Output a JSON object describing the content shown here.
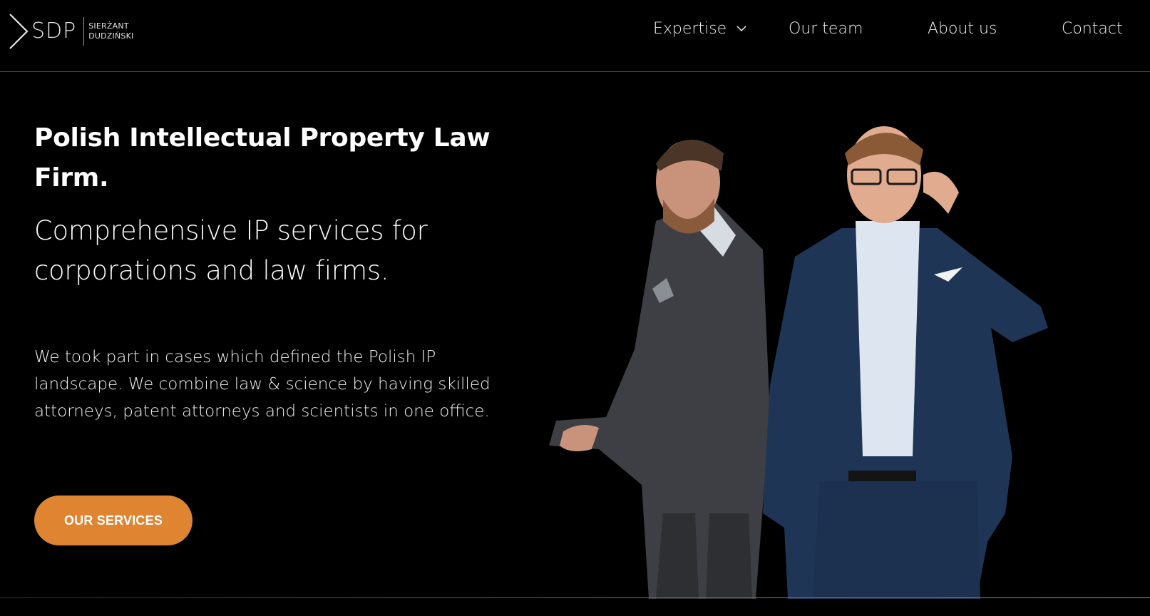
{
  "header": {
    "logo": {
      "abbr": "SDP",
      "name_line1": "SIERŻANT",
      "name_line2": "DUDZIŃSKI",
      "accent": "#d9873a"
    },
    "nav": {
      "expertise": "Expertise",
      "team": "Our team",
      "about": "About us",
      "contact": "Contact"
    }
  },
  "hero": {
    "title": "Polish Intellectual Property Law Firm.",
    "subtitle": "Comprehensive IP services for corporations and law firms.",
    "body": "We took part in cases which defined the Polish IP landscape. We combine law & science by having skilled attorneys, patent attorneys and scientists in one office.",
    "cta_label": "OUR SERVICES",
    "cta_color": "#df8431"
  }
}
